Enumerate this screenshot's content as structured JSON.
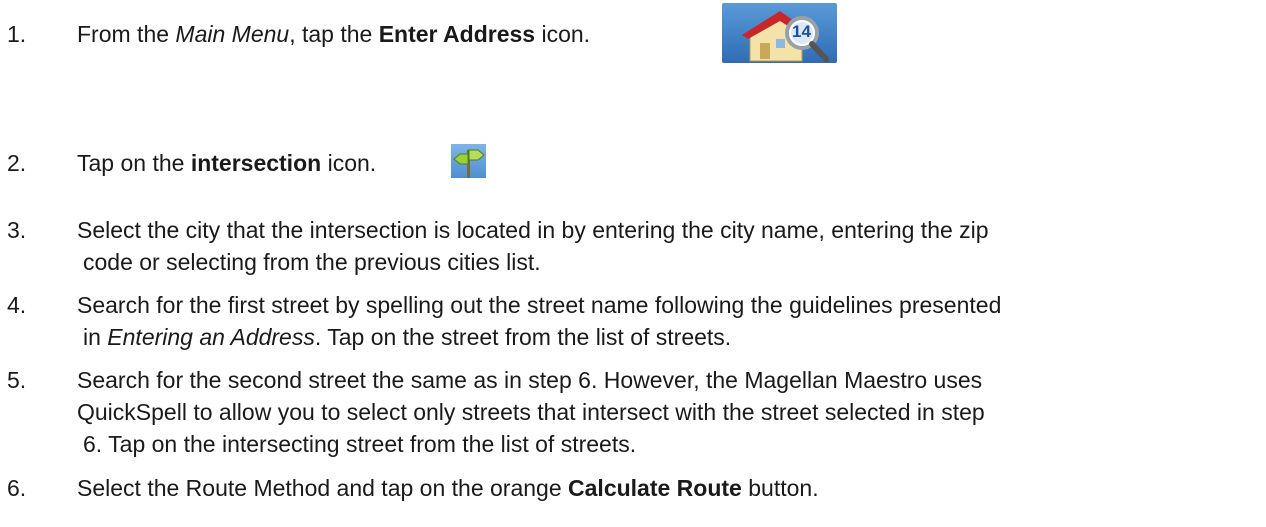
{
  "steps": [
    {
      "number": "1.",
      "t1": "From the ",
      "t2": "Main Menu",
      "t3": ", tap the ",
      "t4": "Enter Address",
      "t5": " icon."
    },
    {
      "number": "2.",
      "t1": "Tap on the ",
      "t2": "intersection",
      "t3": " icon."
    },
    {
      "number": "3.",
      "line1": "Select the city that the intersection is located in by entering the city name, entering the zip",
      "line2": "code or selecting from the previous cities list."
    },
    {
      "number": "4.",
      "line1": "Search for the first street by spelling out the street name following the guidelines presented",
      "l2a": "in ",
      "l2b": "Entering an Address",
      "l2c": ".  Tap on the street from the list of streets."
    },
    {
      "number": "5.",
      "line1": "Search for the second street the same as in step 6.  However, the Magellan Maestro uses",
      "line2": "QuickSpell to allow you to select only streets that intersect with the street selected in step",
      "line3": "6.  Tap on the intersecting street from the list of streets."
    },
    {
      "number": "6.",
      "t1": "Select the Route Method and tap on the orange ",
      "t2": "Calculate Route",
      "t3": " button."
    }
  ],
  "icons": {
    "enter_address": "enter-address-icon",
    "enter_address_badge": "14",
    "intersection": "intersection-icon"
  }
}
